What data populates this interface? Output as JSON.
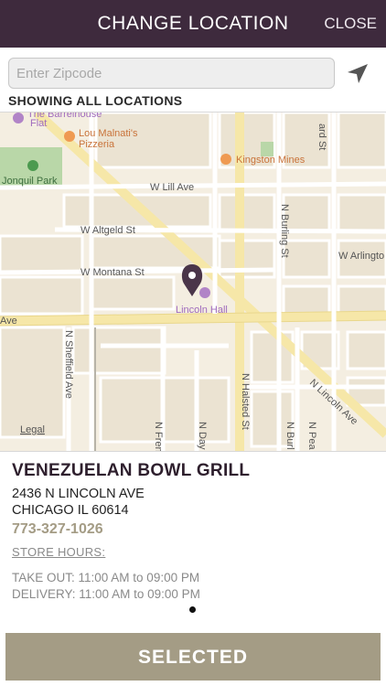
{
  "header": {
    "title": "CHANGE LOCATION",
    "close_label": "CLOSE"
  },
  "search": {
    "placeholder": "Enter Zipcode",
    "value": ""
  },
  "filter_label": "SHOWING ALL LOCATIONS",
  "map": {
    "labels": {
      "barrelhouse": "The Barrelhouse",
      "flat": "Flat",
      "lou1": "Lou Malnati's",
      "lou2": "Pizzeria",
      "kingston": "Kingston Mines",
      "jonquil": "Jonquil Park",
      "lill": "W Lill Ave",
      "altgeld": "W Altgeld St",
      "montana": "W Montana St",
      "arlington": "W Arlingto",
      "burling": "N Burling St",
      "halsted": "N Halsted St",
      "lincoln_ave": "N Lincoln Ave",
      "sheffield": "N Sheffield Ave",
      "lincoln_hall": "Lincoln Hall",
      "ave": "Ave",
      "legal": "Legal",
      "fren": "N Fren",
      "day": "N Day",
      "burl2": "N Burl",
      "pea": "N Pea",
      "ard": "ard St"
    }
  },
  "store": {
    "name": "VENEZUELAN BOWL GRILL",
    "address_line1": "2436 N LINCOLN AVE",
    "address_line2": "CHICAGO IL 60614",
    "phone": "773-327-1026",
    "hours_link": "STORE HOURS:",
    "take_out": "TAKE OUT: 11:00 AM to 09:00 PM",
    "delivery": "DELIVERY: 11:00 AM to 09:00 PM"
  },
  "select_button": "SELECTED",
  "colors": {
    "header_bg": "#3e2a3d",
    "accent": "#a49c85",
    "pin": "#4a3549"
  }
}
